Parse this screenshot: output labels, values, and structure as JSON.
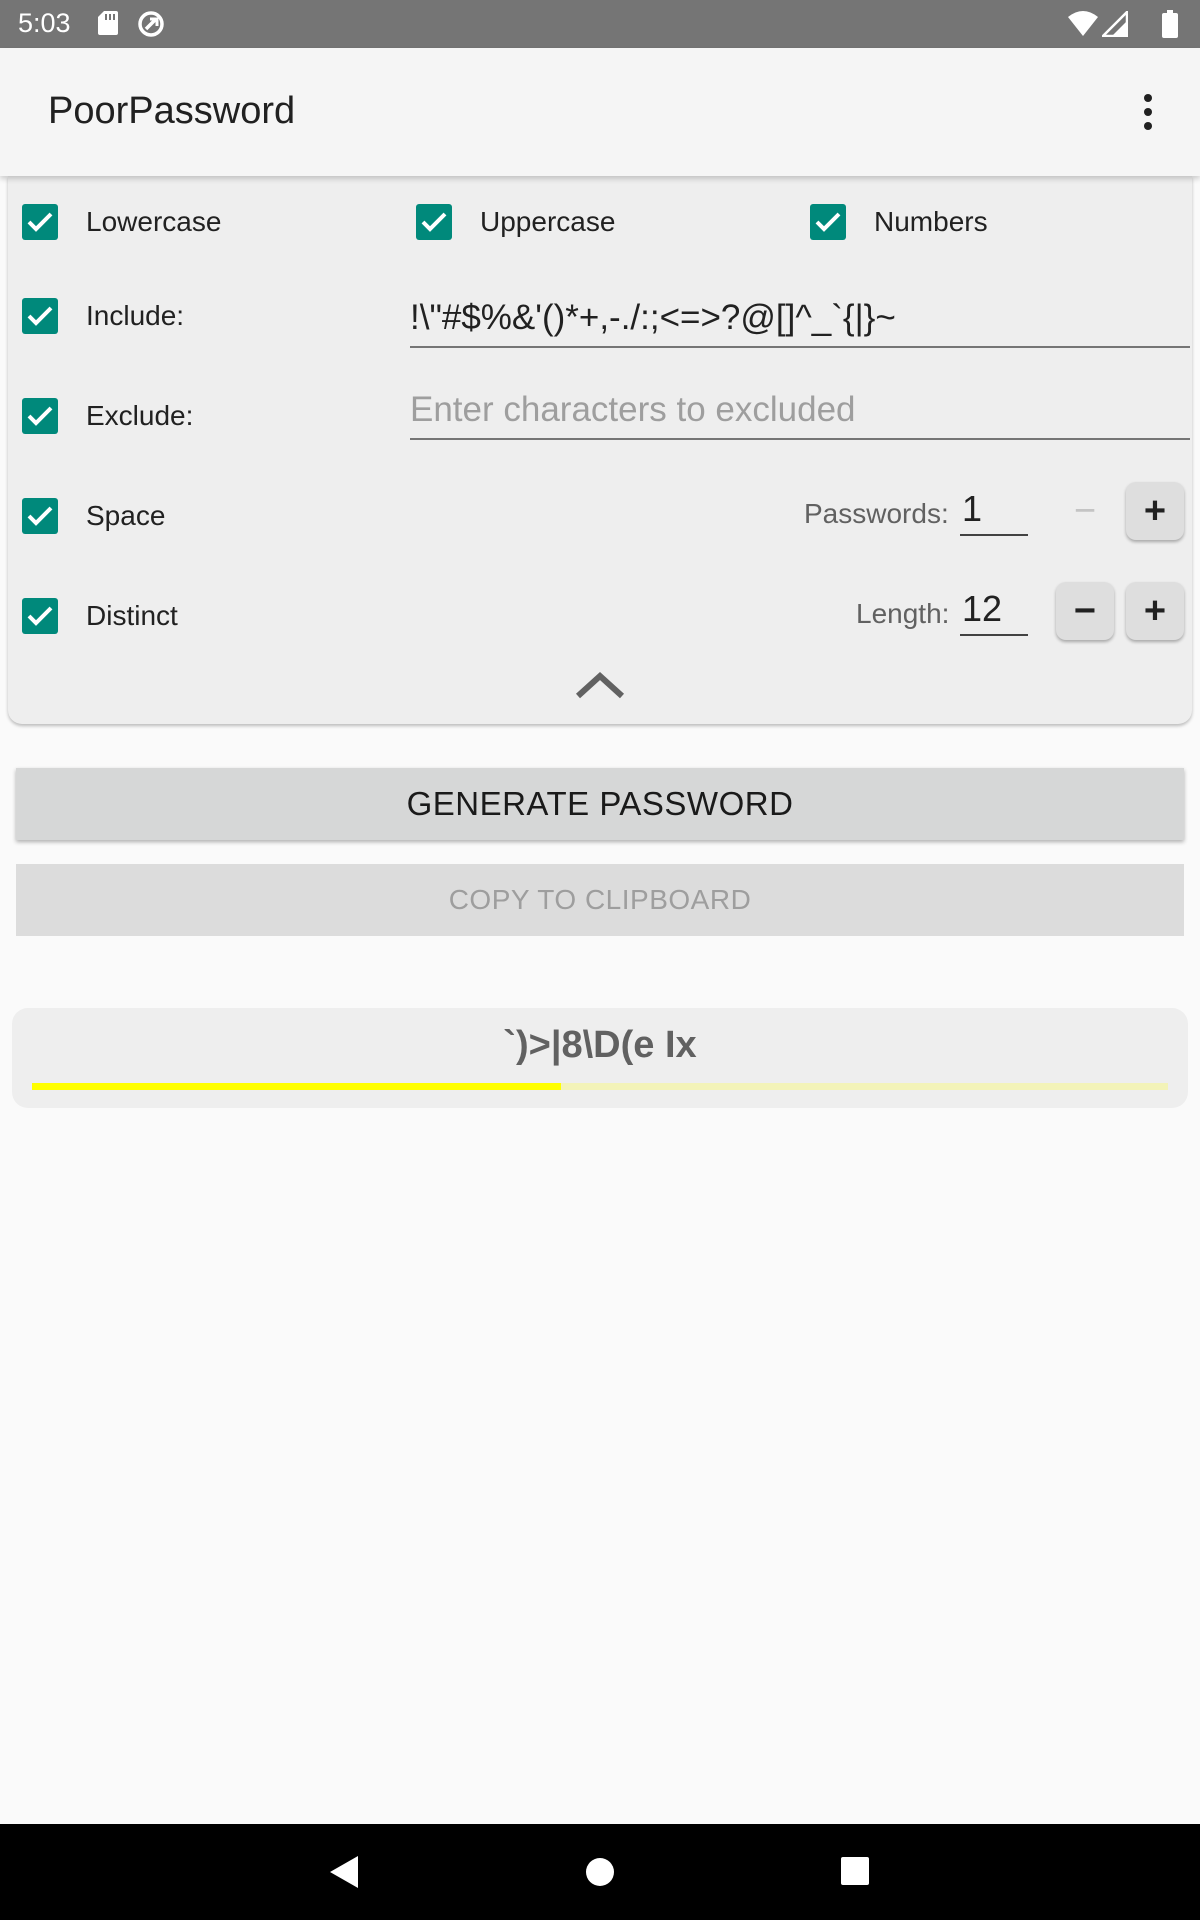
{
  "status_bar": {
    "time": "5:03",
    "icons": [
      "sd-card-icon",
      "sync-icon",
      "wifi-icon",
      "signal-icon",
      "battery-icon"
    ]
  },
  "app_bar": {
    "title": "PoorPassword",
    "menu_icon": "more-vert-icon"
  },
  "options": {
    "lowercase": {
      "label": "Lowercase",
      "checked": true
    },
    "uppercase": {
      "label": "Uppercase",
      "checked": true
    },
    "numbers": {
      "label": "Numbers",
      "checked": true
    },
    "include": {
      "label": "Include:",
      "checked": true,
      "value": "!\\\"#$%&'()*+,-./:;<=>?@[]^_`{|}~"
    },
    "exclude": {
      "label": "Exclude:",
      "checked": true,
      "value": "",
      "placeholder": "Enter characters to excluded"
    },
    "space": {
      "label": "Space",
      "checked": true
    },
    "distinct": {
      "label": "Distinct",
      "checked": true
    },
    "passwords": {
      "label": "Passwords:",
      "value": "1",
      "minus": "−",
      "plus": "+"
    },
    "length": {
      "label": "Length:",
      "value": "12",
      "minus": "−",
      "plus": "+"
    },
    "collapse_icon": "chevron-up-icon"
  },
  "actions": {
    "generate": "GENERATE PASSWORD",
    "copy": "COPY TO CLIPBOARD"
  },
  "result": {
    "password": "`)>|8\\D(e Ix",
    "strength_fraction": 0.466,
    "strength_color": "#ffff00",
    "strength_track_color": "#f3f3b8"
  },
  "colors": {
    "accent": "#00897b",
    "status_bar": "#757575"
  },
  "nav_bar": {
    "icons": [
      "back-icon",
      "home-icon",
      "recents-icon"
    ]
  }
}
